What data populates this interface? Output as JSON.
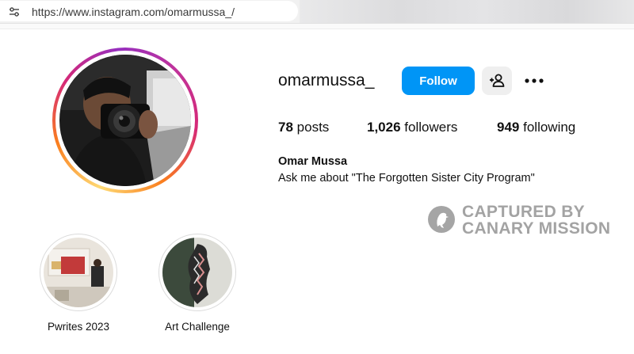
{
  "browser": {
    "url": "https://www.instagram.com/omarmussa_/",
    "site_info_icon": "tune-icon"
  },
  "profile": {
    "username": "omarmussa_",
    "follow_label": "Follow",
    "suggest_icon": "add-person-icon",
    "more_icon": "more-horizontal-icon",
    "stats": {
      "posts_count": "78",
      "posts_label": "posts",
      "followers_count": "1,026",
      "followers_label": "followers",
      "following_count": "949",
      "following_label": "following"
    },
    "full_name": "Omar Mussa",
    "bio": "Ask me about \"The Forgotten Sister City Program\""
  },
  "watermark": {
    "line1": "CAPTURED BY",
    "line2": "CANARY MISSION",
    "icon": "canary-bird-icon"
  },
  "highlights": [
    {
      "label": "Pwrites 2023"
    },
    {
      "label": "Art Challenge"
    }
  ],
  "colors": {
    "follow_button": "#0095f6",
    "secondary_button": "#efefef",
    "watermark": "#8a8a8a"
  }
}
